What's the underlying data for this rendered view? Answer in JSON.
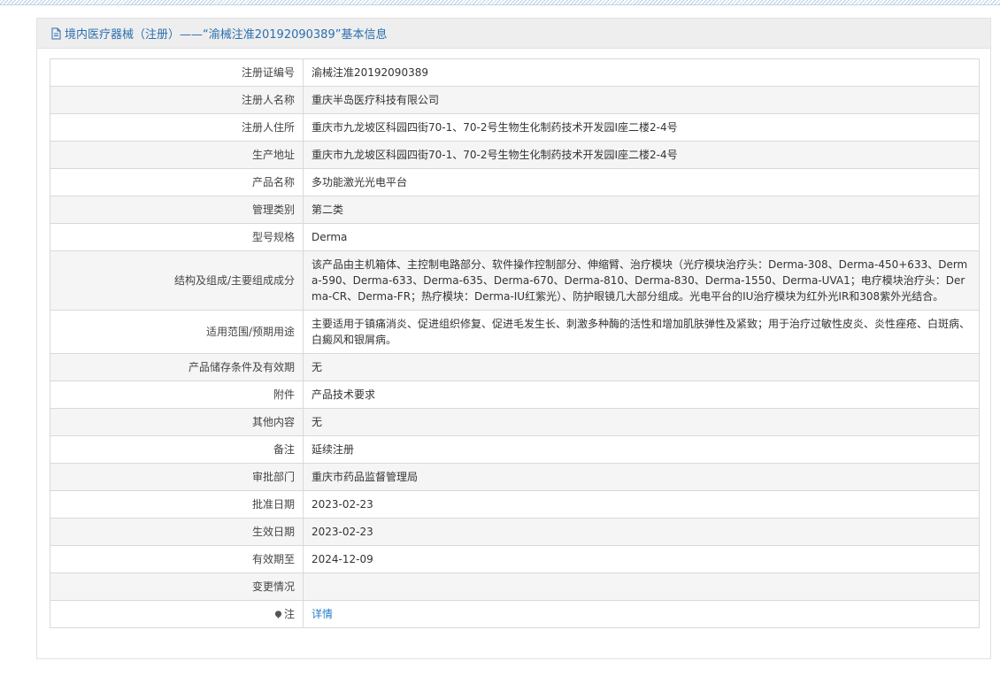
{
  "header": {
    "title": "境内医疗器械（注册）——“渝械注准20192090389”基本信息",
    "icon": "document-icon"
  },
  "rows": [
    {
      "label": "注册证编号",
      "value": "渝械注准20192090389"
    },
    {
      "label": "注册人名称",
      "value": "重庆半岛医疗科技有限公司"
    },
    {
      "label": "注册人住所",
      "value": "重庆市九龙坡区科园四街70-1、70-2号生物生化制药技术开发园I座二楼2-4号"
    },
    {
      "label": "生产地址",
      "value": "重庆市九龙坡区科园四街70-1、70-2号生物生化制药技术开发园I座二楼2-4号"
    },
    {
      "label": "产品名称",
      "value": "多功能激光光电平台"
    },
    {
      "label": "管理类别",
      "value": "第二类"
    },
    {
      "label": "型号规格",
      "value": "Derma"
    },
    {
      "label": "结构及组成/主要组成成分",
      "value": "该产品由主机箱体、主控制电路部分、软件操作控制部分、伸缩臂、治疗模块（光疗模块治疗头：Derma-308、Derma-450+633、Derma-590、Derma-633、Derma-635、Derma-670、Derma-810、Derma-830、Derma-1550、Derma-UVA1；电疗模块治疗头：Derma-CR、Derma-FR；热疗模块：Derma-IU红紫光）、防护眼镜几大部分组成。光电平台的IU治疗模块为红外光IR和308紫外光结合。"
    },
    {
      "label": "适用范围/预期用途",
      "value": "主要适用于镇痛消炎、促进组织修复、促进毛发生长、刺激多种酶的活性和增加肌肤弹性及紧致；用于治疗过敏性皮炎、炎性痤疮、白斑病、白癜风和银屑病。"
    },
    {
      "label": "产品储存条件及有效期",
      "value": "无"
    },
    {
      "label": "附件",
      "value": "产品技术要求"
    },
    {
      "label": "其他内容",
      "value": "无"
    },
    {
      "label": "备注",
      "value": "延续注册"
    },
    {
      "label": "审批部门",
      "value": "重庆市药品监督管理局"
    },
    {
      "label": "批准日期",
      "value": "2023-02-23"
    },
    {
      "label": "生效日期",
      "value": "2023-02-23"
    },
    {
      "label": "有效期至",
      "value": "2024-12-09"
    },
    {
      "label": "变更情况",
      "value": ""
    }
  ],
  "note_row": {
    "icon": "info-pin-icon",
    "label": "注",
    "link_text": "详情"
  },
  "colors": {
    "accent": "#2a6fb0",
    "link": "#2a7dc9",
    "header_bg": "#eeeeee",
    "stripe_row_bg": "#f5f5f5",
    "border": "#d9d9d9"
  }
}
